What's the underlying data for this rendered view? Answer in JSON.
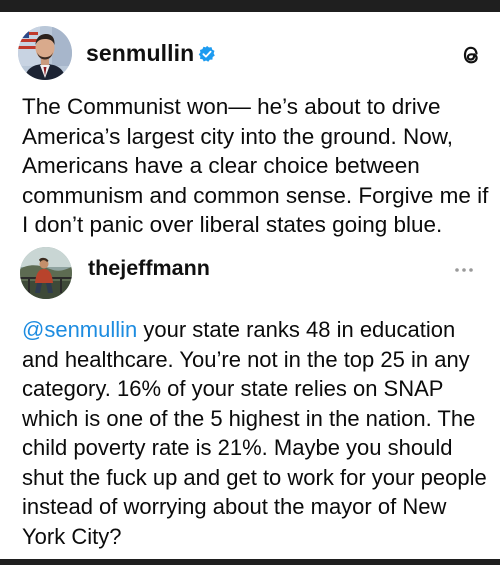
{
  "post1": {
    "username": "senmullin",
    "verified": true,
    "avatar_icon": "senator-portrait-avatar",
    "app_icon": "threads-logo-icon",
    "text": "The Communist won— he’s about to drive America’s largest city into the ground. Now, Americans have a clear choice between communism and common sense. Forgive me if I don’t panic over liberal states going blue."
  },
  "post2": {
    "username": "thejeffmann",
    "avatar_icon": "outdoor-photo-avatar",
    "menu_icon": "more-options-icon",
    "mention": "@senmullin",
    "text": " your state ranks 48 in education and healthcare. You’re not in the top 25 in any category. 16% of your state relies on SNAP which is one of the 5 highest in the nation. The child poverty rate is 21%. Maybe you should shut the fuck up and get to work for your people instead of worrying about the mayor of New York City?"
  },
  "colors": {
    "link": "#1d8ce0",
    "verified_badge": "#1d9bf0",
    "text": "#0b0b0b",
    "frame": "#1f1f1f"
  }
}
